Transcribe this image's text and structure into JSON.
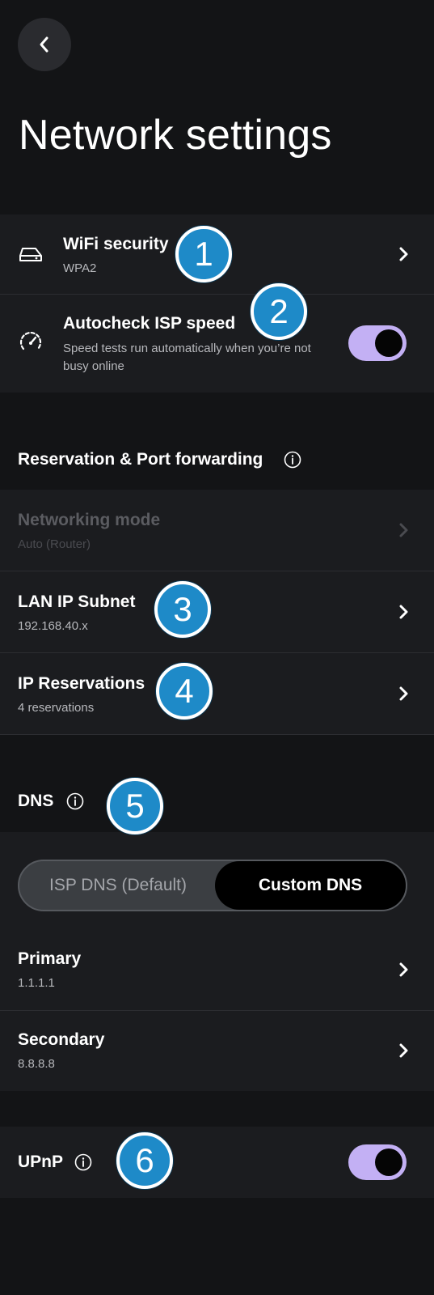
{
  "header": {
    "title": "Network settings"
  },
  "wifi_card": {
    "wifi_security": {
      "label": "WiFi security",
      "value": "WPA2"
    },
    "autocheck": {
      "label": "Autocheck ISP speed",
      "description": "Speed tests run automatically when you’re not busy online",
      "enabled": true
    }
  },
  "reservation_section": {
    "heading": "Reservation & Port forwarding",
    "items": [
      {
        "label": "Networking mode",
        "value": "Auto (Router)",
        "disabled": true
      },
      {
        "label": "LAN IP Subnet",
        "value": "192.168.40.x"
      },
      {
        "label": "IP Reservations",
        "value": "4 reservations"
      }
    ]
  },
  "dns_section": {
    "heading": "DNS",
    "options": [
      "ISP DNS (Default)",
      "Custom DNS"
    ],
    "selected": "Custom DNS",
    "primary": {
      "label": "Primary",
      "value": "1.1.1.1"
    },
    "secondary": {
      "label": "Secondary",
      "value": "8.8.8.8"
    }
  },
  "upnp": {
    "label": "UPnP",
    "enabled": true
  },
  "annotations": [
    "1",
    "2",
    "3",
    "4",
    "5",
    "6"
  ],
  "colors": {
    "background": "#131416",
    "card": "#1b1c1f",
    "toggle_on": "#c3b0f4",
    "badge": "#1e8ac8"
  }
}
